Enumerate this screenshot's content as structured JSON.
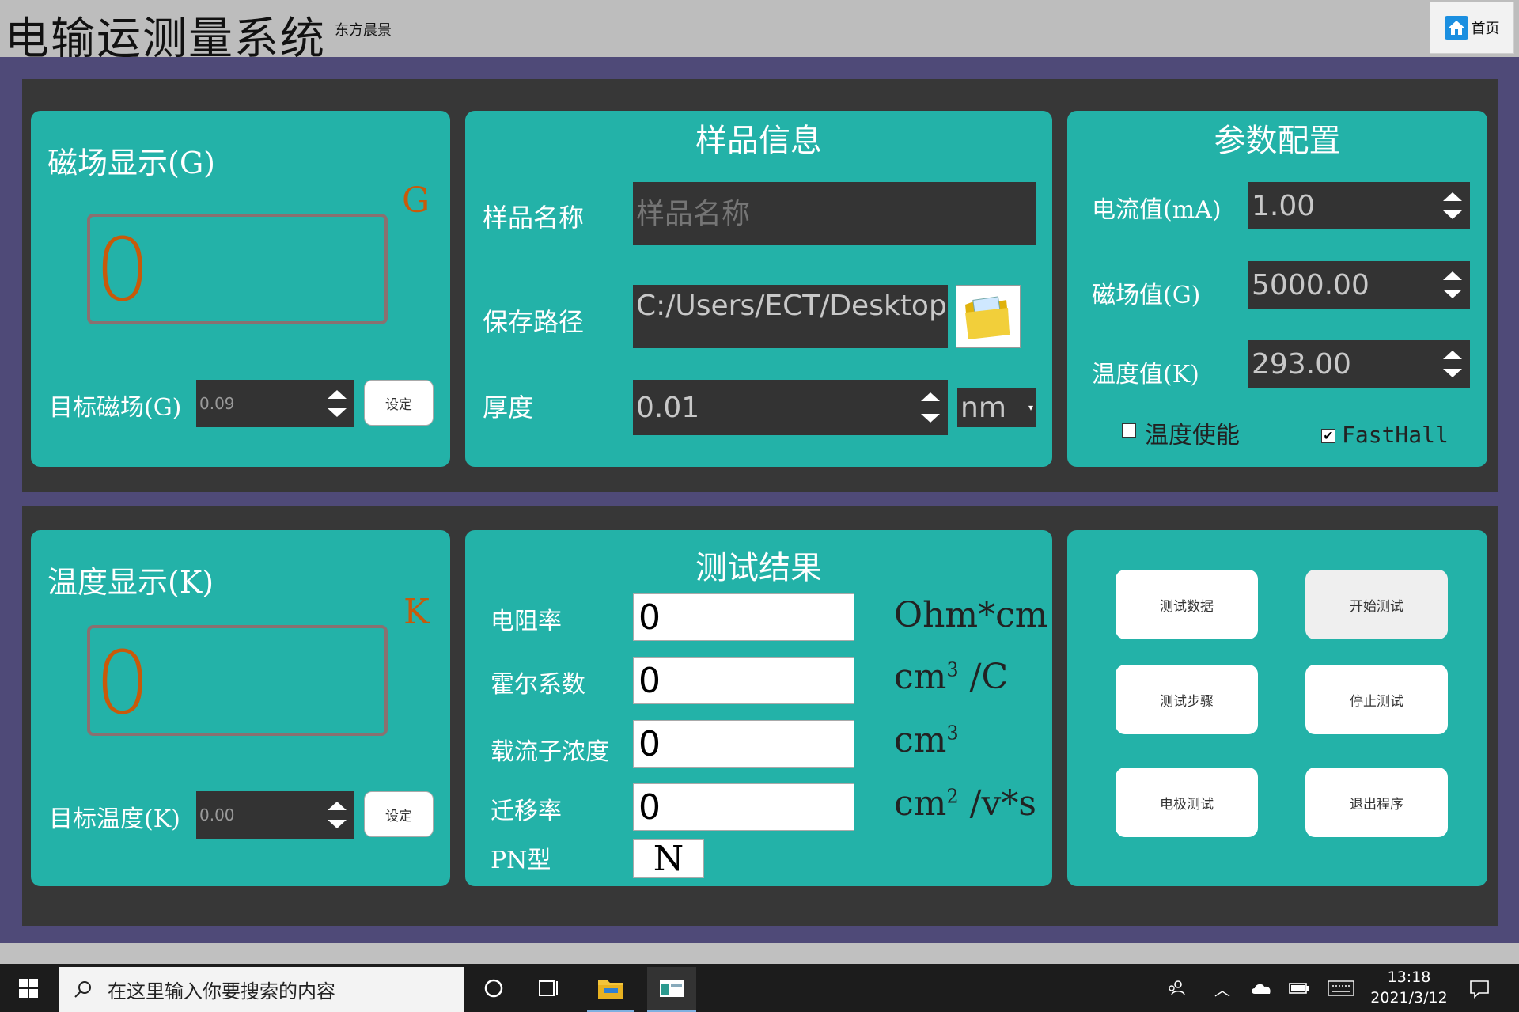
{
  "app": {
    "title": "电输运测量系统",
    "subtitle": "东方晨景",
    "home_label": "首页"
  },
  "magnetic": {
    "title": "磁场显示(G)",
    "unit": "G",
    "value": "0",
    "target_label": "目标磁场(G)",
    "target_value": "0.09",
    "set_label": "设定"
  },
  "temperature": {
    "title": "温度显示(K)",
    "unit": "K",
    "value": "0",
    "target_label": "目标温度(K)",
    "target_value": "0.00",
    "set_label": "设定"
  },
  "sample": {
    "title": "样品信息",
    "name_label": "样品名称",
    "name_placeholder": "样品名称",
    "path_label": "保存路径",
    "path_value": "C:/Users/ECT/Desktop",
    "thickness_label": "厚度",
    "thickness_value": "0.01",
    "thickness_unit": "nm"
  },
  "params": {
    "title": "参数配置",
    "current_label": "电流值(mA)",
    "current_value": "1.00",
    "field_label": "磁场值(G)",
    "field_value": "5000.00",
    "temp_label": "温度值(K)",
    "temp_value": "293.00",
    "temp_enable_label": "温度使能",
    "temp_enable_checked": false,
    "fasthall_label": "FastHall",
    "fasthall_checked": true
  },
  "results": {
    "title": "测试结果",
    "rows": [
      {
        "label": "电阻率",
        "value": "0",
        "unit": "Ohm*cm"
      },
      {
        "label": "霍尔系数",
        "value": "0",
        "unit_base": "cm",
        "unit_sup": "3",
        "unit_tail": " /C"
      },
      {
        "label": "载流子浓度",
        "value": "0",
        "unit_base": "cm",
        "unit_sup": "3",
        "unit_tail": ""
      },
      {
        "label": "迁移率",
        "value": "0",
        "unit_base": "cm",
        "unit_sup": "2",
        "unit_tail": " /v*s"
      }
    ],
    "pn_label": "PN型",
    "pn_value": "N"
  },
  "actions": {
    "test_data": "测试数据",
    "start_test": "开始测试",
    "test_steps": "测试步骤",
    "stop_test": "停止测试",
    "electrode_test": "电极测试",
    "exit_program": "退出程序"
  },
  "taskbar": {
    "search_placeholder": "在这里输入你要搜索的内容",
    "time": "13:18",
    "date": "2021/3/12"
  }
}
